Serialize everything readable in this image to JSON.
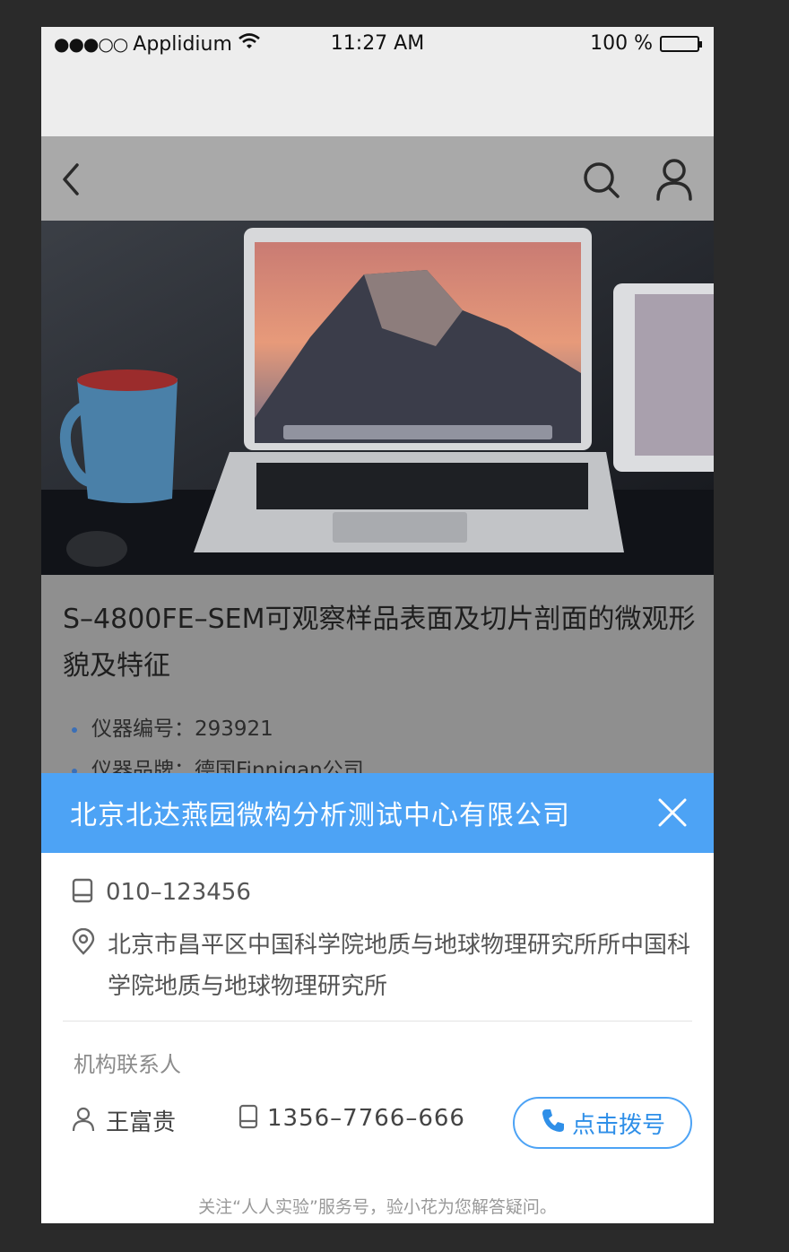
{
  "status_bar": {
    "signal": "●●●○○",
    "carrier": "Applidium",
    "time": "11:27 AM",
    "battery": "100 %"
  },
  "navbar": {
    "back_icon": "chevron-left-icon",
    "search_icon": "search-icon",
    "user_icon": "user-icon"
  },
  "product": {
    "title": "S–4800FE–SEM可观察样品表面及切片剖面的微观形貌及特征",
    "specs": [
      {
        "label": "仪器编号：",
        "value": "293921"
      },
      {
        "label": "仪器品牌：",
        "value": "德国Finnigan公司"
      }
    ]
  },
  "sheet": {
    "title": "北京北达燕园微构分析测试中心有限公司",
    "phone": "010–123456",
    "address": "北京市昌平区中国科学院地质与地球物理研究所所中国科学院地质与地球物理研究所",
    "contact_label": "机构联系人",
    "contact_name": "王富贵",
    "contact_mobile": "1356–7766–666",
    "dial_label": "点击拨号",
    "footer_note": "关注“人人实验”服务号，验小花为您解答疑问。"
  },
  "colors": {
    "accent": "#4da3f5",
    "dim_overlay": "#8f8f8f"
  }
}
